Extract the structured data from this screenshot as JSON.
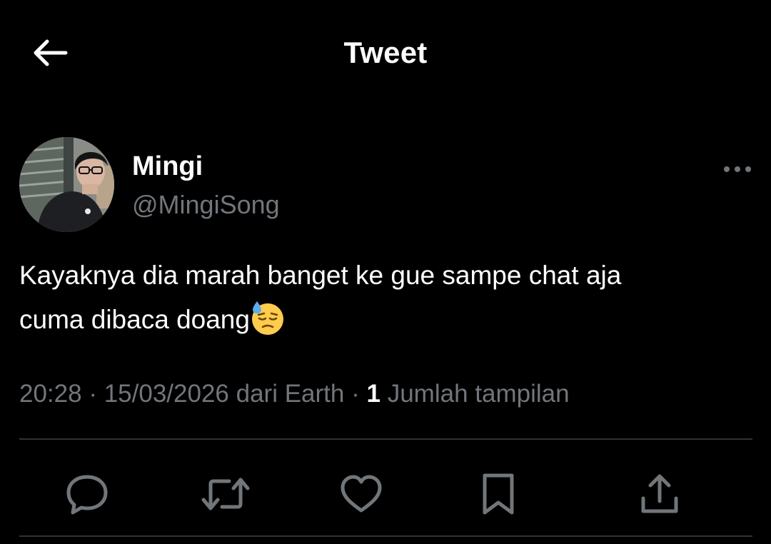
{
  "header": {
    "title": "Tweet",
    "back_icon": "arrow-left-icon"
  },
  "tweet": {
    "author": {
      "display_name": "Mingi",
      "handle": "@MingiSong",
      "avatar_icon": "avatar-photo"
    },
    "text_line1": "Kayaknya dia marah banget ke gue sampe chat aja",
    "text_line2": "cuma dibaca doang",
    "emoji": "downcast-face-with-sweat-emoji",
    "time": "20:28",
    "separator": "·",
    "date": "15/03/2026",
    "source": "dari Earth",
    "views_count": "1",
    "views_label": "Jumlah tampilan"
  },
  "actions": [
    {
      "name": "reply",
      "icon": "reply-icon"
    },
    {
      "name": "retweet",
      "icon": "retweet-icon"
    },
    {
      "name": "like",
      "icon": "heart-icon"
    },
    {
      "name": "bookmark",
      "icon": "bookmark-icon"
    },
    {
      "name": "share",
      "icon": "share-icon"
    }
  ],
  "colors": {
    "background": "#000000",
    "primary_text": "#ffffff",
    "secondary_text": "#71767b",
    "divider": "#2f3336"
  }
}
